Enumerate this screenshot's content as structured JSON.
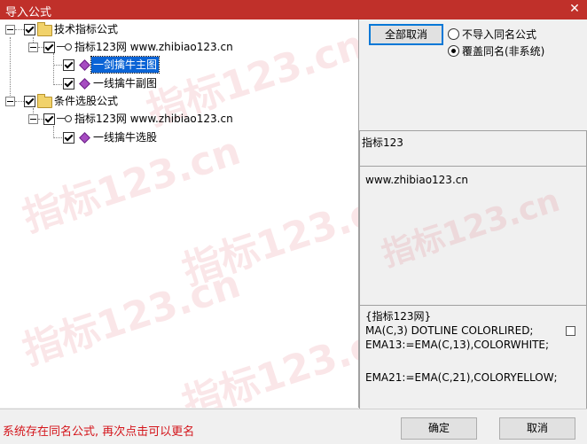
{
  "window": {
    "title": "导入公式",
    "close_label": "✕"
  },
  "tree": {
    "group1_label": "技术指标公式",
    "group1_site": "指标123网 www.zhibiao123.cn",
    "group1_item1": "一剑擒牛主图",
    "group1_item2": "一线擒牛副图",
    "group2_label": "条件选股公式",
    "group2_site": "指标123网 www.zhibiao123.cn",
    "group2_item1": "一线擒牛选股"
  },
  "right": {
    "cancel_all_label": "全部取消",
    "radio1_label": "不导入同名公式",
    "radio2_label": "覆盖同名(非系统)",
    "radio_selected": "覆盖同名(非系统)",
    "author": "指标123",
    "website": "www.zhibiao123.cn",
    "code_lines": [
      "{指标123网}",
      "MA(C,3) DOTLINE COLORLIRED;",
      "EMA13:=EMA(C,13),COLORWHITE;",
      "",
      "EMA21:=EMA(C,21),COLORYELLOW;"
    ]
  },
  "footer": {
    "status_text": "系统存在同名公式, 再次点击可以更名",
    "ok_label": "确定",
    "cancel_label": "取消"
  },
  "watermark": "指标123.cn",
  "colors": {
    "titlebar": "#c0302a",
    "status_text": "#d4151b",
    "selection": "#0a64d6"
  }
}
